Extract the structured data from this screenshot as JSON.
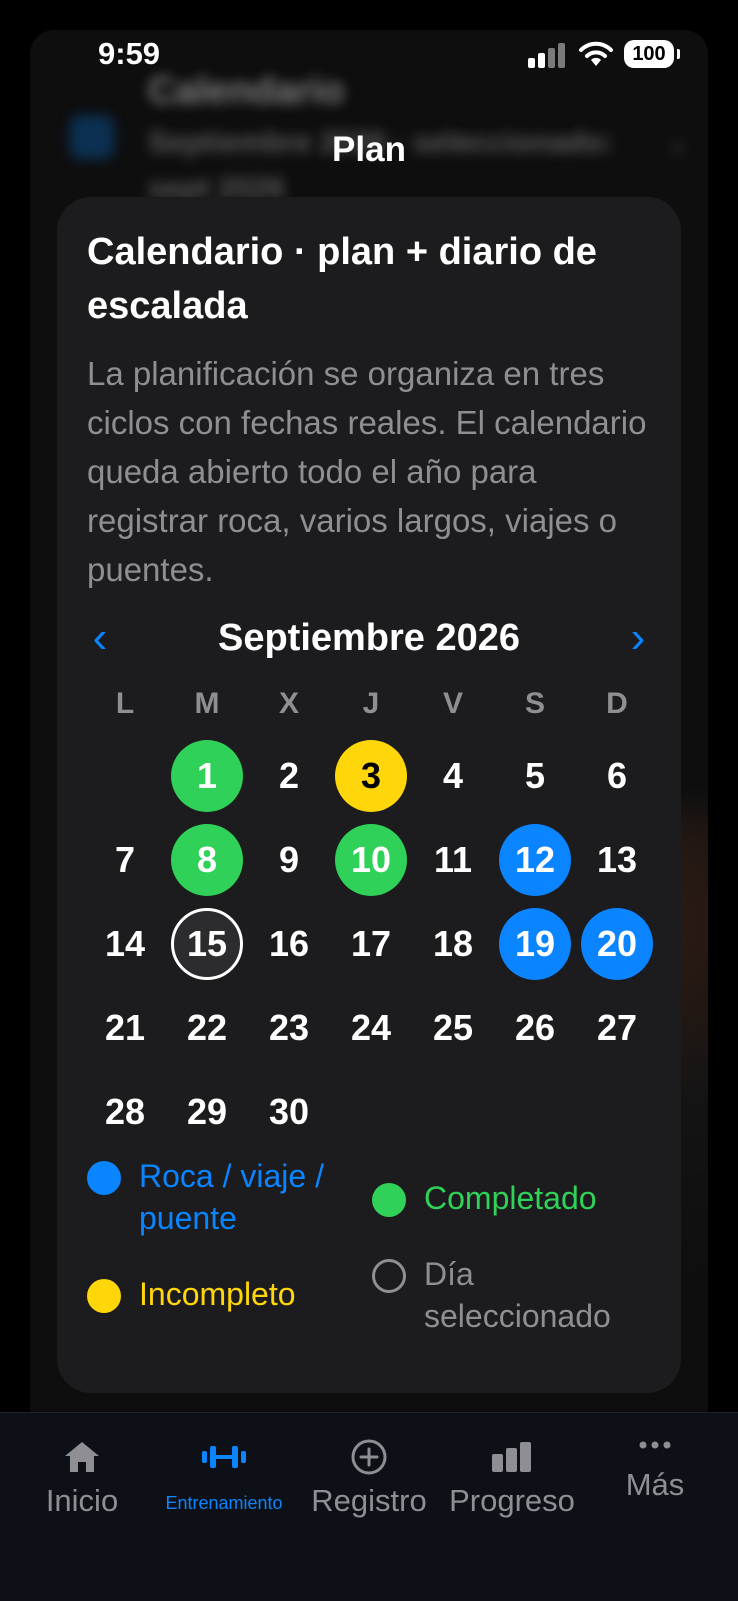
{
  "status_bar": {
    "time": "9:59",
    "battery": "100"
  },
  "background_page": {
    "title": "Calendario",
    "subtitle": "Septiembre 2026 · seleccionado: sept 2026"
  },
  "nav": {
    "title": "Plan"
  },
  "card": {
    "title": "Calendario · plan + diario de escalada",
    "description": "La planificación se organiza en tres ciclos con fechas reales. El calendario queda abierto todo el año para registrar roca, varios largos, viajes o puentes."
  },
  "calendar": {
    "month_label": "Septiembre 2026",
    "weekdays": [
      "L",
      "M",
      "X",
      "J",
      "V",
      "S",
      "D"
    ],
    "leading_blanks": 1,
    "days": [
      {
        "n": "1",
        "status": "completed"
      },
      {
        "n": "2",
        "status": ""
      },
      {
        "n": "3",
        "status": "incomplete"
      },
      {
        "n": "4",
        "status": ""
      },
      {
        "n": "5",
        "status": ""
      },
      {
        "n": "6",
        "status": ""
      },
      {
        "n": "7",
        "status": ""
      },
      {
        "n": "8",
        "status": "completed"
      },
      {
        "n": "9",
        "status": ""
      },
      {
        "n": "10",
        "status": "completed"
      },
      {
        "n": "11",
        "status": ""
      },
      {
        "n": "12",
        "status": "trip"
      },
      {
        "n": "13",
        "status": ""
      },
      {
        "n": "14",
        "status": ""
      },
      {
        "n": "15",
        "status": "selected"
      },
      {
        "n": "16",
        "status": ""
      },
      {
        "n": "17",
        "status": ""
      },
      {
        "n": "18",
        "status": ""
      },
      {
        "n": "19",
        "status": "trip"
      },
      {
        "n": "20",
        "status": "trip"
      },
      {
        "n": "21",
        "status": ""
      },
      {
        "n": "22",
        "status": ""
      },
      {
        "n": "23",
        "status": ""
      },
      {
        "n": "24",
        "status": ""
      },
      {
        "n": "25",
        "status": ""
      },
      {
        "n": "26",
        "status": ""
      },
      {
        "n": "27",
        "status": ""
      },
      {
        "n": "28",
        "status": ""
      },
      {
        "n": "29",
        "status": ""
      },
      {
        "n": "30",
        "status": ""
      }
    ]
  },
  "legend": {
    "trip": "Roca / viaje / puente",
    "completed": "Completado",
    "incomplete": "Incompleto",
    "selected": "Día seleccionado"
  },
  "colors": {
    "trip": "#0a84ff",
    "completed": "#30d158",
    "incomplete": "#ffd60a",
    "accent": "#0a84ff"
  },
  "tabbar": {
    "items": [
      {
        "label": "Inicio",
        "icon": "house-icon",
        "active": false
      },
      {
        "label": "Entrenamiento",
        "icon": "dumbbell-icon",
        "active": true
      },
      {
        "label": "Registro",
        "icon": "plus-circle-icon",
        "active": false
      },
      {
        "label": "Progreso",
        "icon": "bar-chart-icon",
        "active": false
      },
      {
        "label": "Más",
        "icon": "ellipsis-icon",
        "active": false
      }
    ]
  }
}
